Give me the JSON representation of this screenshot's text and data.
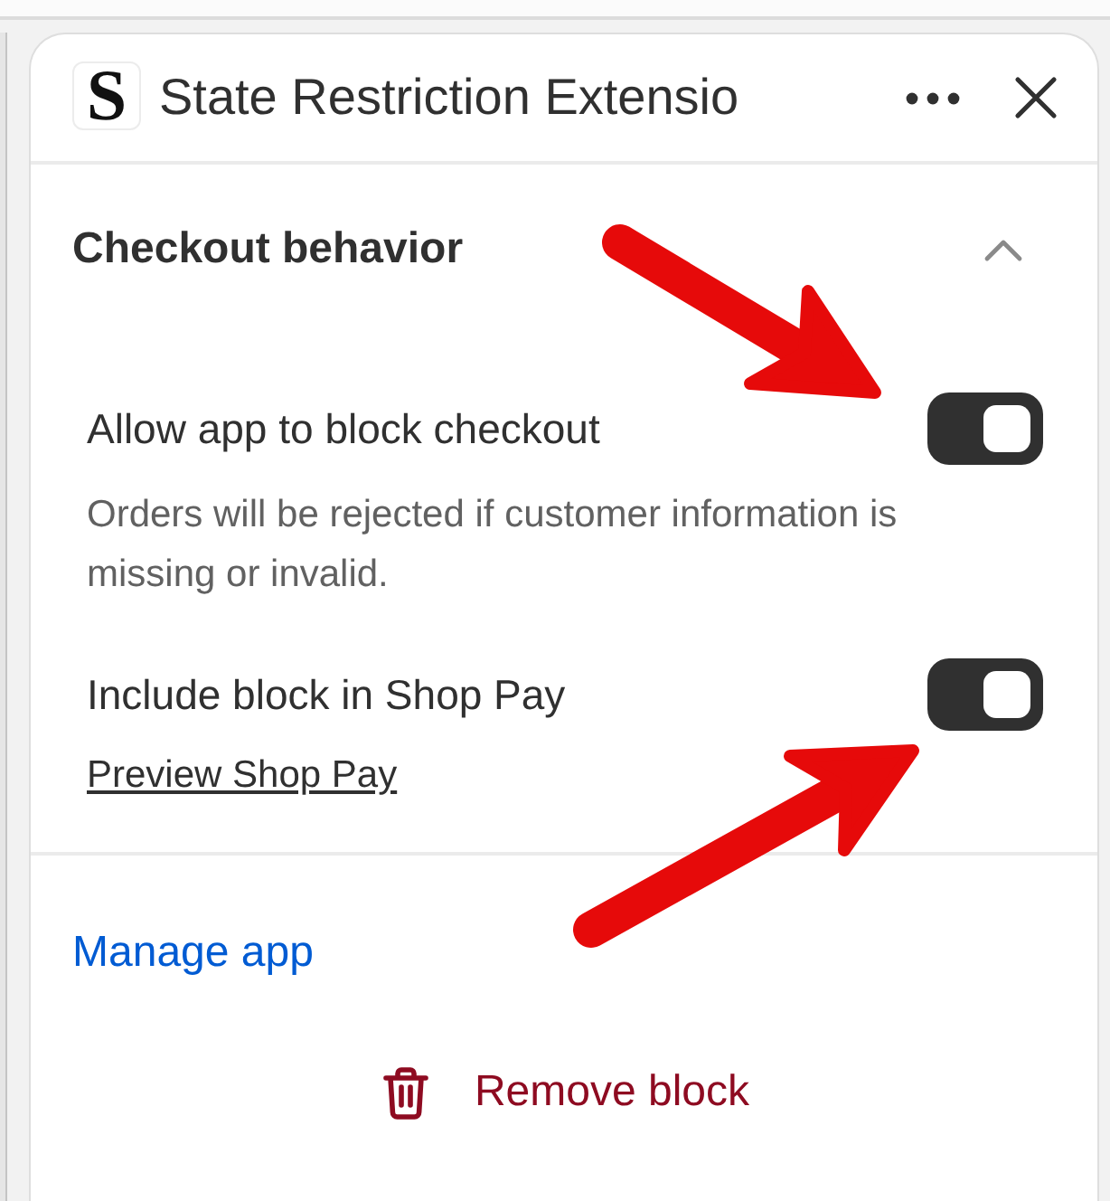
{
  "header": {
    "logo_letter": "S",
    "title": "State Restriction Extensio"
  },
  "section": {
    "title": "Checkout behavior",
    "expanded": true,
    "settings": [
      {
        "label": "Allow app to block checkout",
        "on": true,
        "help": "Orders will be rejected if customer information is missing or invalid."
      },
      {
        "label": "Include block in Shop Pay",
        "on": true,
        "link": "Preview Shop Pay"
      }
    ]
  },
  "footer": {
    "link": "Manage app",
    "remove_button": "Remove block"
  }
}
